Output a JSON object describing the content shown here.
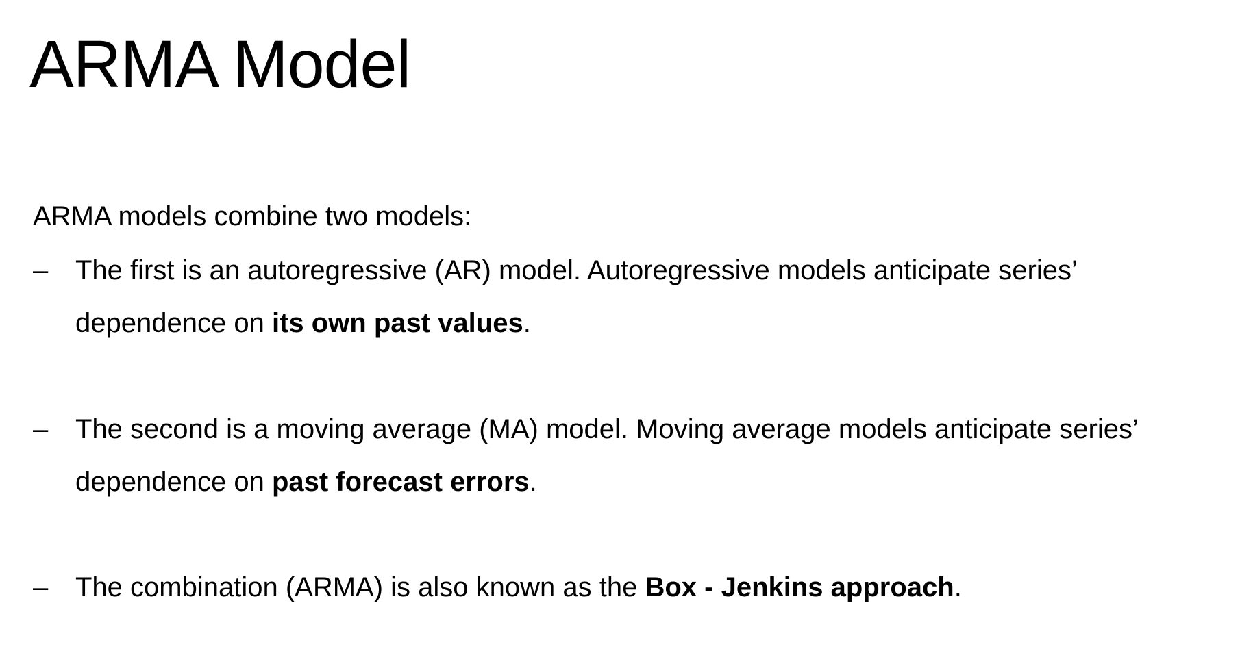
{
  "slide": {
    "title": "ARMA Model",
    "intro": "ARMA models combine two models:",
    "bullet_marker": "–",
    "bullets": [
      {
        "line1": "The first is an autoregressive (AR) model. Autoregressive models anticipate series’",
        "line2_prefix": "dependence on ",
        "line2_bold": "its own past values",
        "line2_suffix": "."
      },
      {
        "line1": "The second is a moving average (MA) model. Moving average models anticipate series’",
        "line2_prefix": "dependence on ",
        "line2_bold": "past forecast errors",
        "line2_suffix": "."
      },
      {
        "line1_prefix": "The combination (ARMA) is also known as the ",
        "line1_bold": "Box - Jenkins approach",
        "line1_suffix": "."
      }
    ]
  }
}
